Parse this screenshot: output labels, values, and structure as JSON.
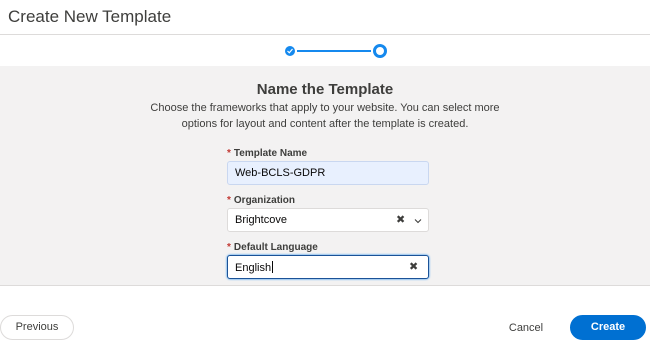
{
  "header": {
    "title": "Create New Template"
  },
  "stepper": {
    "steps": [
      "complete",
      "current"
    ]
  },
  "main": {
    "title": "Name the Template",
    "description": "Choose the frameworks that apply to your website. You can select more options for layout and content after the template is created."
  },
  "form": {
    "required_marker": "*",
    "template_name": {
      "label": "Template Name",
      "value": "Web-BCLS-GDPR"
    },
    "organization": {
      "label": "Organization",
      "value": "Brightcove"
    },
    "default_language": {
      "label": "Default Language",
      "value": "English"
    }
  },
  "footer": {
    "previous_label": "Previous",
    "cancel_label": "Cancel",
    "create_label": "Create"
  },
  "colors": {
    "accent": "#0070d2",
    "step": "#1589ee",
    "required": "#c23934"
  }
}
